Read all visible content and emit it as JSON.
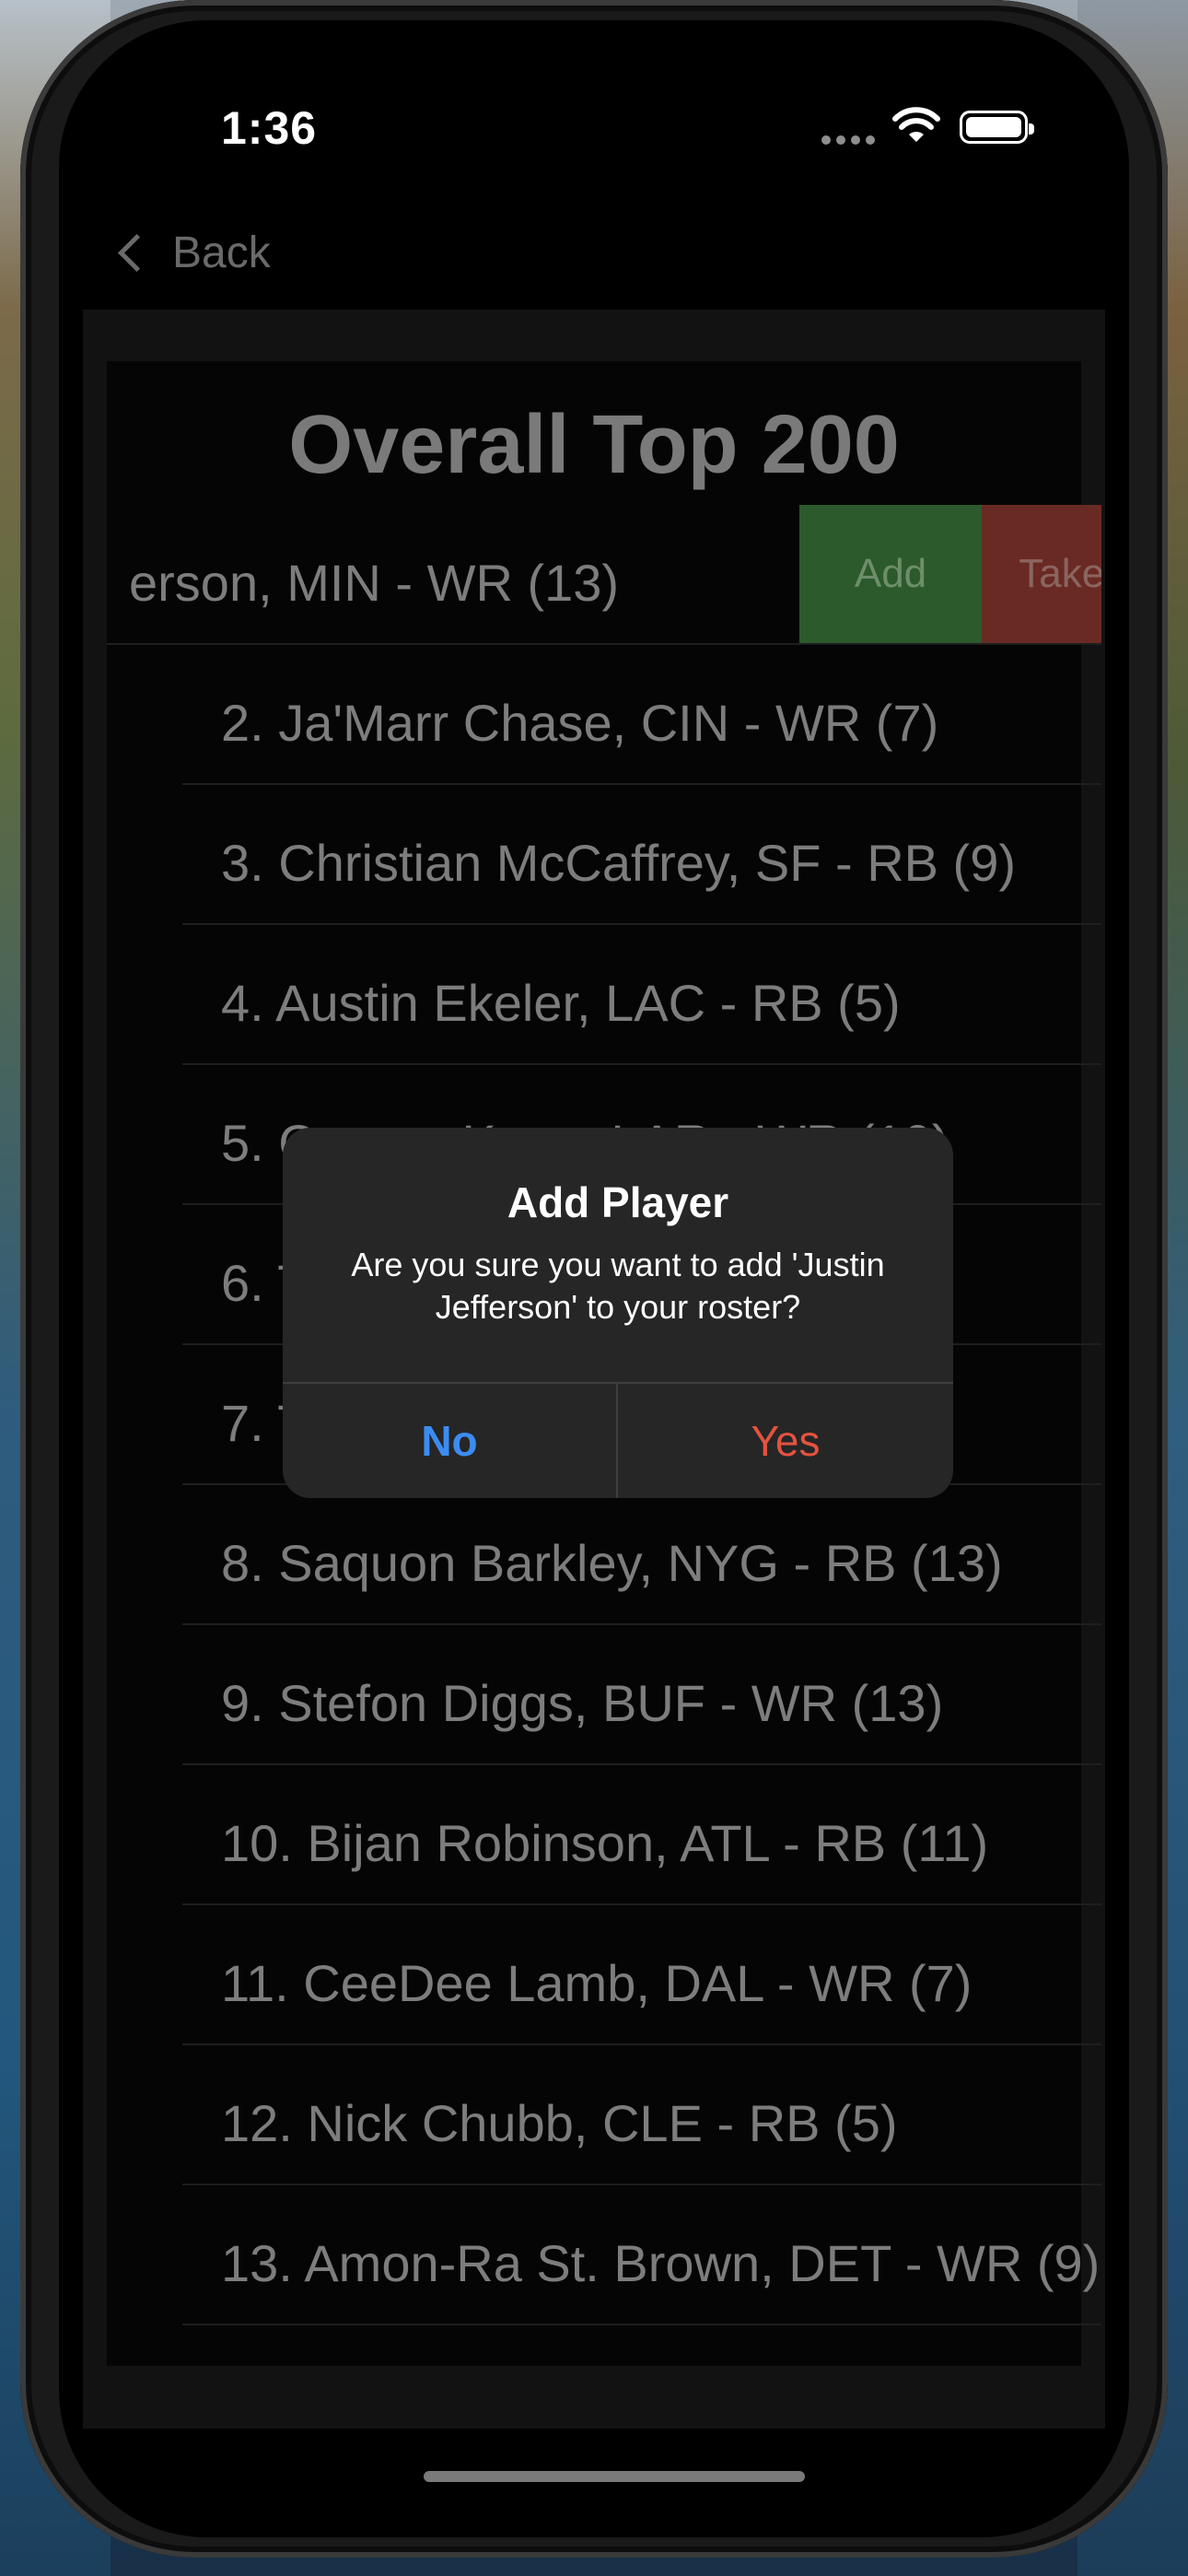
{
  "status_bar": {
    "time": "1:36"
  },
  "nav": {
    "back_label": "Back"
  },
  "page": {
    "title": "Overall Top 200"
  },
  "swipe_actions": {
    "add_label": "Add",
    "taken_label": "Taken"
  },
  "players": [
    "erson,  MIN - WR (13)",
    "2.  Ja'Marr Chase,  CIN - WR (7)",
    "3.  Christian McCaffrey,  SF - RB (9)",
    "4.  Austin Ekeler,  LAC - RB (5)",
    "5.  Cooper Kupp,  LAR - WR (10)",
    "6.  T",
    "7.  Tr",
    "8.  Saquon Barkley,  NYG - RB (13)",
    "9.  Stefon Diggs,  BUF - WR (13)",
    "10.  Bijan Robinson,  ATL - RB (11)",
    "11.  CeeDee Lamb,  DAL - WR (7)",
    "12.  Nick Chubb,  CLE - RB (5)",
    "13.  Amon-Ra St. Brown,  DET - WR (9)"
  ],
  "alert": {
    "title": "Add Player",
    "message": "Are you sure you want to add 'Justin Jefferson' to your roster?",
    "no_label": "No",
    "yes_label": "Yes"
  },
  "colors": {
    "add_green": "#2c5a2d",
    "taken_red": "#6a2a24",
    "alert_no_blue": "#3c8cf0",
    "alert_yes_red": "#e2533f"
  }
}
